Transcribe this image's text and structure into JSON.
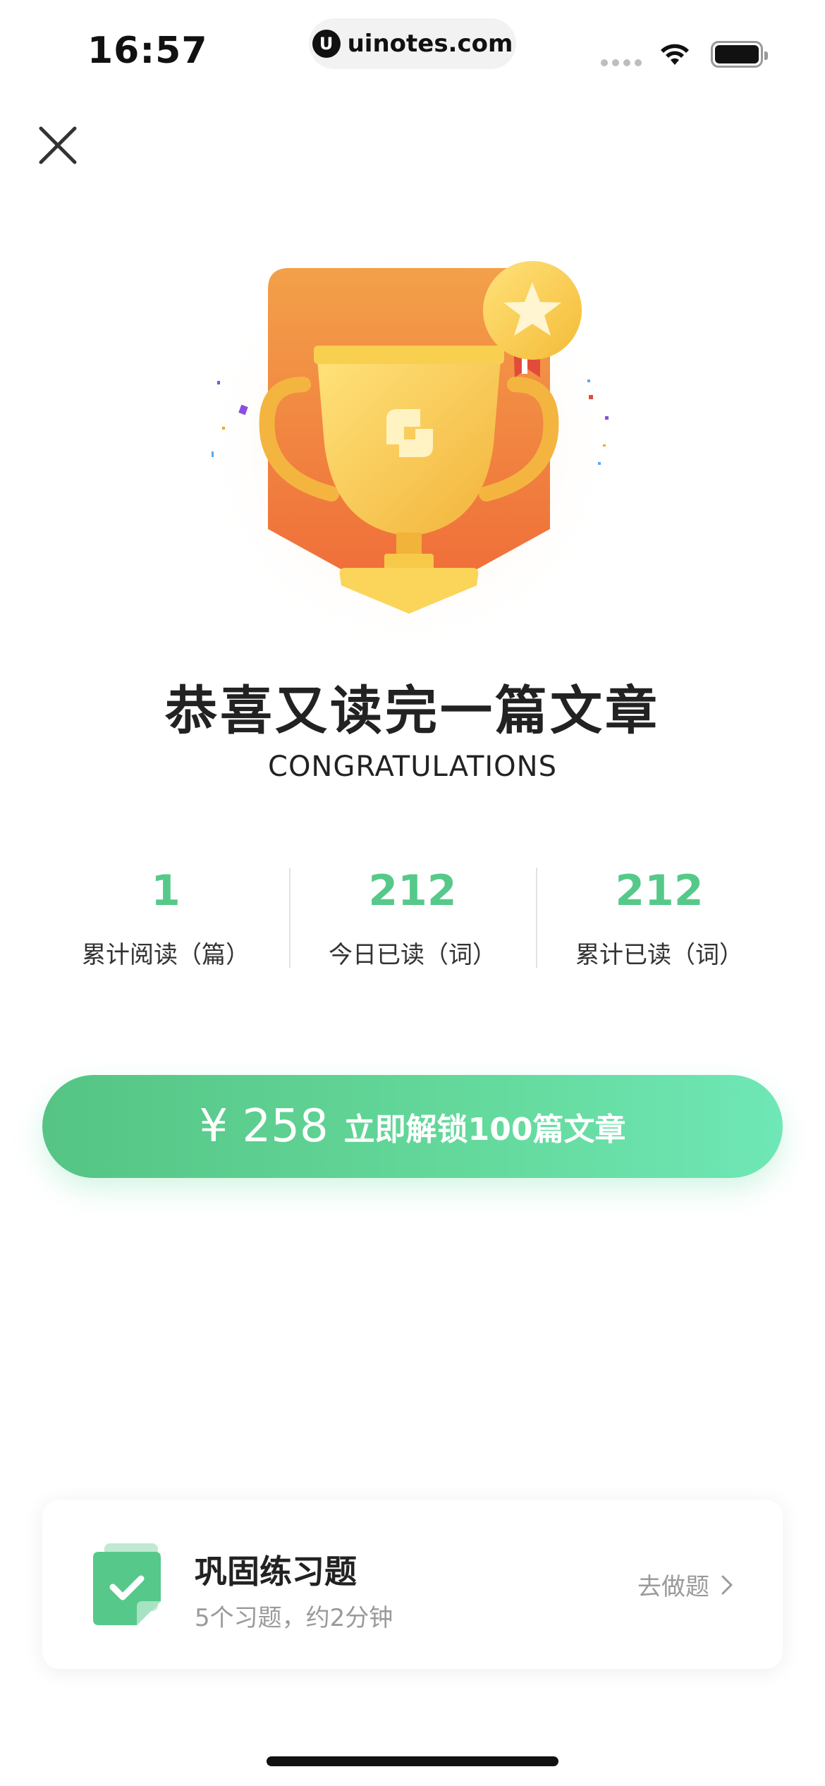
{
  "status_bar": {
    "time": "16:57",
    "url": "uinotes.com",
    "url_logo": "U",
    "icons": [
      "signal-icon",
      "wifi-icon",
      "battery-icon"
    ]
  },
  "header": {
    "close_icon": "close-icon"
  },
  "hero": {
    "title": "恭喜又读完一篇文章",
    "subtitle": "CONGRATULATIONS"
  },
  "stats": [
    {
      "value": "1",
      "label": "累计阅读（篇）"
    },
    {
      "value": "212",
      "label": "今日已读（词）"
    },
    {
      "value": "212",
      "label": "累计已读（词）"
    }
  ],
  "unlock": {
    "price": "¥ 258",
    "label": "立即解锁100篇文章"
  },
  "practice": {
    "title": "巩固练习题",
    "subtitle": "5个习题，约2分钟",
    "action": "去做题"
  },
  "colors": {
    "accent_green": "#56c98a",
    "button_gradient_start": "#55c484",
    "button_gradient_end": "#6fe7b6",
    "trophy_orange": "#f07a3e",
    "trophy_gold": "#f6c542"
  }
}
